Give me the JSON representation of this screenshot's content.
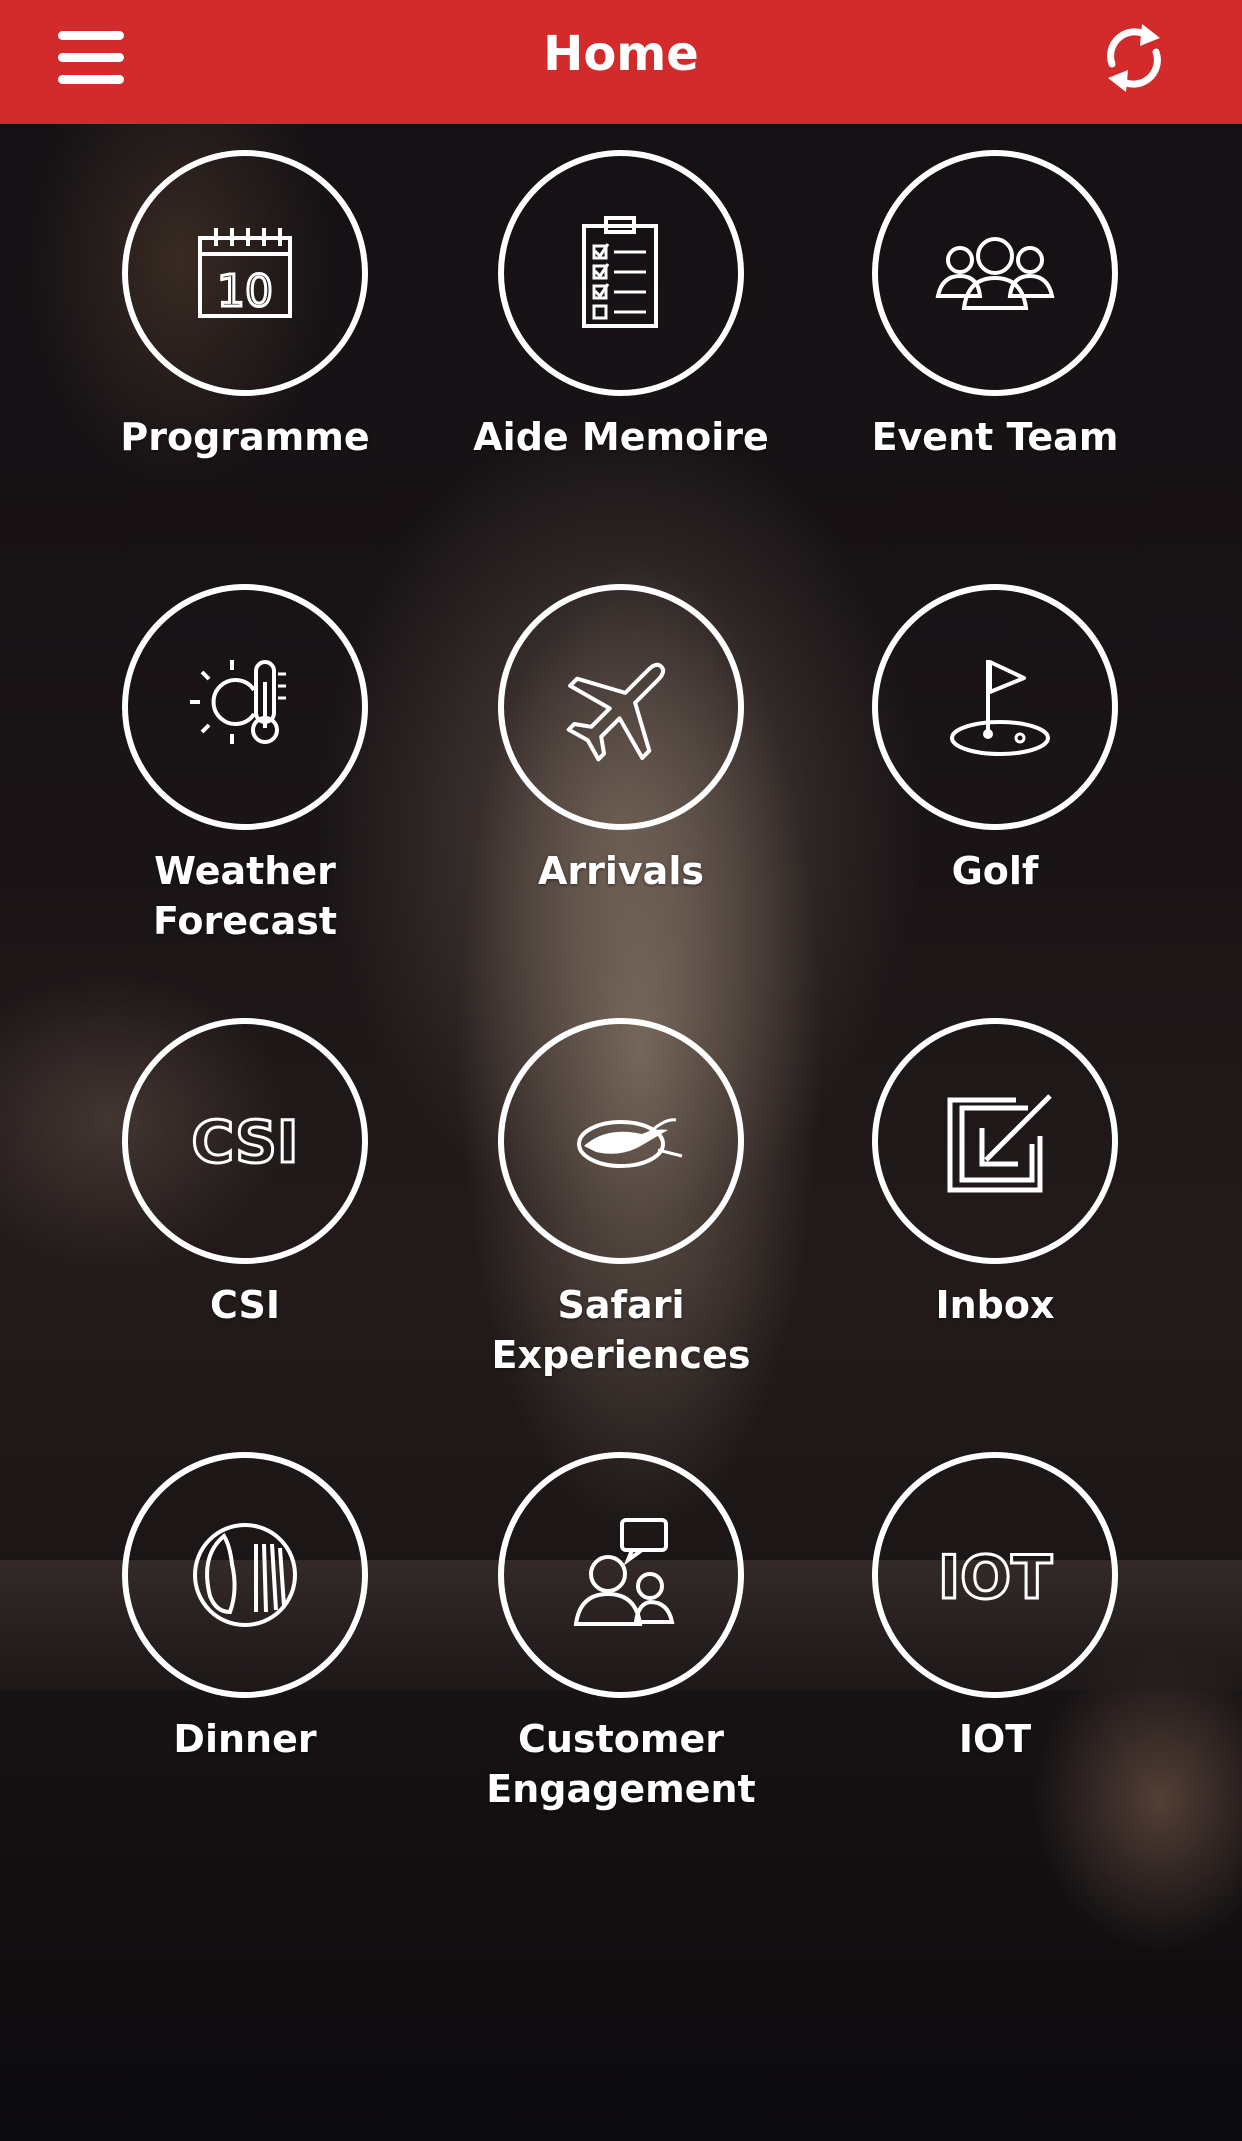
{
  "header": {
    "title": "Home",
    "background_color": "#d32b2b",
    "menu_icon": "hamburger-menu-icon",
    "refresh_icon": "refresh-icon"
  },
  "tiles": [
    {
      "label": "Programme",
      "icon": "calendar-icon"
    },
    {
      "label": "Aide Memoire",
      "icon": "checklist-clipboard-icon"
    },
    {
      "label": "Event Team",
      "icon": "group-people-icon"
    },
    {
      "label": "Weather Forecast",
      "icon": "sun-thermometer-icon"
    },
    {
      "label": "Arrivals",
      "icon": "airplane-icon"
    },
    {
      "label": "Golf",
      "icon": "golf-flag-icon"
    },
    {
      "label": "CSI",
      "icon": "csi-text-icon"
    },
    {
      "label": "Safari Experiences",
      "icon": "leaping-antelope-icon"
    },
    {
      "label": "Inbox",
      "icon": "inbox-arrow-icon"
    },
    {
      "label": "Dinner",
      "icon": "plate-fork-knife-icon"
    },
    {
      "label": "Customer Engagement",
      "icon": "people-speech-bubble-icon"
    },
    {
      "label": "IOT",
      "icon": "iot-text-icon"
    }
  ],
  "calendar_icon_text": "10",
  "csi_icon_text": "CSI",
  "iot_icon_text": "IOT"
}
